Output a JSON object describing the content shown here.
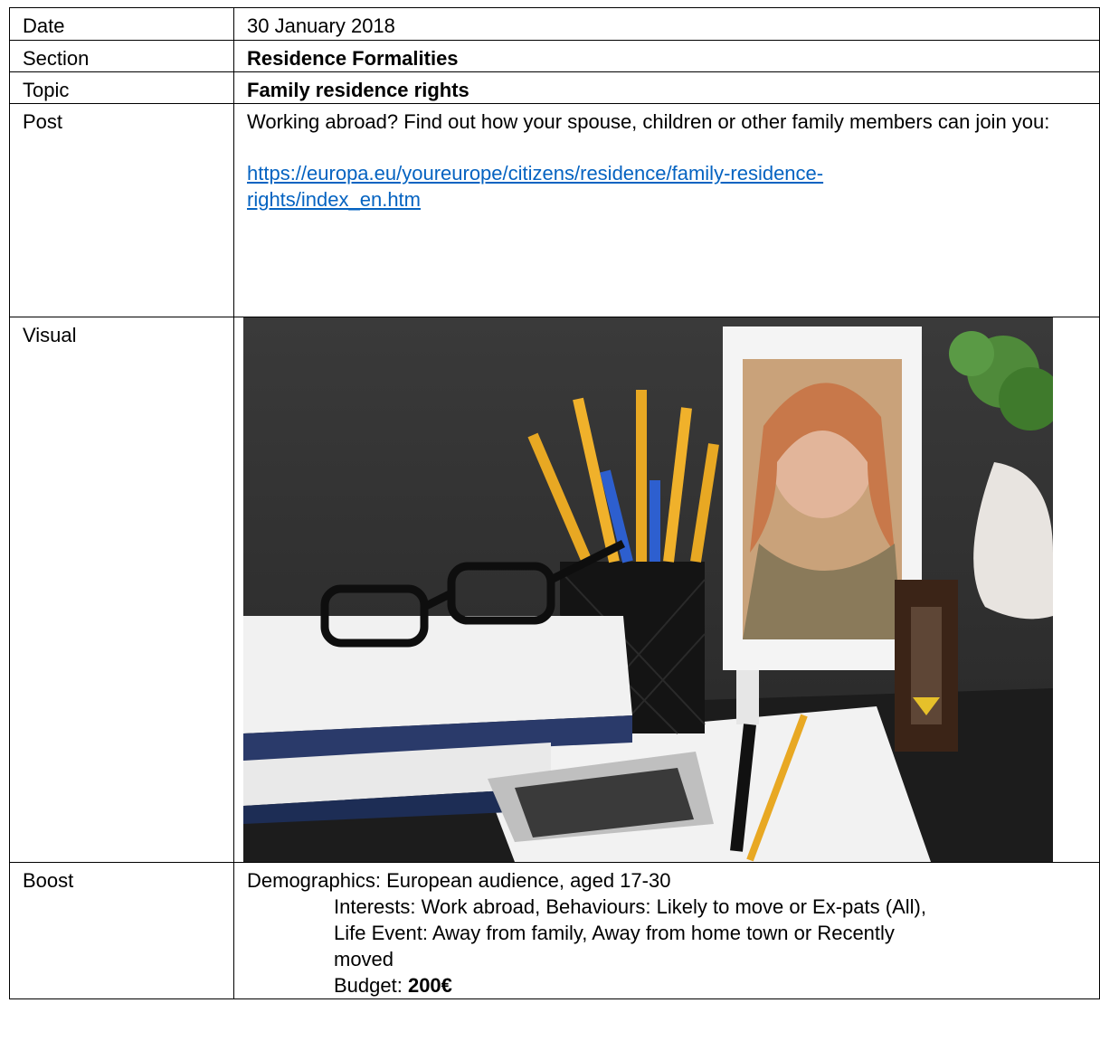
{
  "rows": {
    "date": {
      "label": "Date",
      "value": "30 January 2018"
    },
    "section": {
      "label": "Section",
      "value": "Residence Formalities"
    },
    "topic": {
      "label": "Topic",
      "value": "Family residence rights"
    },
    "post": {
      "label": "Post",
      "text": "Working abroad? Find out how your spouse, children or other family members can join you:",
      "link_line1": "https://europa.eu/youreurope/citizens/residence/family-residence-",
      "link_line2": "rights/index_en.htm"
    },
    "visual": {
      "label": "Visual",
      "image_subject": "desk-with-photo-frame-pencils-glasses-calculator"
    },
    "boost": {
      "label": "Boost",
      "demographics": "Demographics: European audience, aged 17-30",
      "interests_line1": "Interests: Work abroad, Behaviours: Likely to move or Ex-pats (All),",
      "interests_line2": "Life Event: Away from family, Away from home town or Recently",
      "interests_line3": "moved",
      "budget_label": "Budget: ",
      "budget_value": "200€"
    }
  }
}
